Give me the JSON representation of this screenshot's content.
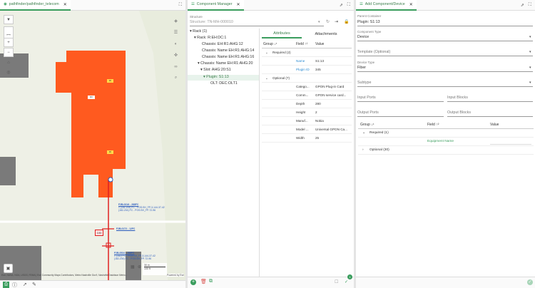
{
  "map": {
    "tab_label": "pathfinder/pathfinder_telecom",
    "scale": {
      "top": "30 m",
      "bottom": "100 ft"
    },
    "attribution": "Esri, NASA, NGA, USGS, FEMA | Esri Community Maps Contributors, Metro Nashville Gov't, Nashville Davidson Metro...",
    "powered_by": "Powered by Esri",
    "badge_100": "100",
    "small_labels": [
      "3F",
      "RV",
      "3F"
    ],
    "labels": [
      {
        "title": "F2B-0316 - 288FC",
        "l1": "1 (181-204) FC - POS:SH_FP-3-144-37-42",
        "l2": "(182-204) FC - POS:SH_FP-72-96"
      },
      {
        "title": "F2B-0172 - 12FC",
        "l1": "",
        "l2": ""
      },
      {
        "title": "F2B-0534 - 288FC",
        "l1": "1 (182) FC - POS:SH_FP-3-144-37-42",
        "l2": "(182-204) FC - POS:SH_FP-72-96"
      }
    ]
  },
  "component_manager": {
    "tab_label": "Component Manager",
    "structure_label": "Structure",
    "structure_value": "Structure: TN-MH-000010",
    "tree": [
      "Rack (1)",
      "Rack: R:EH:DC:1",
      "Chassis: EH:R1:AHG:12",
      "Chassis: Name EH:R1:AHG:14",
      "Chassis: Name EH:R1:AHG:16",
      "Chassis: Name EH:R1:AHG:20",
      "Slot: AHG:20:S1",
      "Plugin: S1:13",
      "OLT: DEC:OLT1"
    ],
    "tabs": [
      "Attributes",
      "Attachments"
    ],
    "table_headers": [
      "Group",
      "Field",
      "Value"
    ],
    "required_group": "Required (2)",
    "optional_group": "Optional (7)",
    "required_rows": [
      {
        "field": "Name",
        "value": "S1:13"
      },
      {
        "field": "Plugin ID",
        "value": "345"
      }
    ],
    "optional_rows": [
      {
        "field": "Catego...",
        "value": "GPON Plug-in Card"
      },
      {
        "field": "Comm...",
        "value": "GPON service card..."
      },
      {
        "field": "Depth",
        "value": "280"
      },
      {
        "field": "Height",
        "value": "2"
      },
      {
        "field": "Manuf...",
        "value": "Nokia"
      },
      {
        "field": "Model ...",
        "value": "Universal GPON Ca..."
      },
      {
        "field": "Width",
        "value": "25"
      }
    ],
    "badge_count": "1"
  },
  "add_component": {
    "tab_label": "Add Component/Device",
    "parent_container_label": "Parent Container",
    "parent_container_value": "Plugin: S1:13",
    "component_type_label": "Component Type",
    "component_type_value": "Device",
    "template_label": "Template (Optional)",
    "device_type_label": "Device Type",
    "device_type_value": "Fiber",
    "subtype_label": "Subtype",
    "input_ports": "Input Ports",
    "input_blocks": "Input Blocks",
    "output_ports": "Output Ports",
    "output_blocks": "Output Blocks",
    "table_headers": [
      "Group",
      "Field",
      "Value"
    ],
    "required_group": "Required (1)",
    "required_field": "Equipment Name",
    "optional_group": "Optional (30)"
  },
  "colors": {
    "accent": "#3a9d5d",
    "building": "#ff5a1f",
    "link": "#2a8ad1"
  }
}
